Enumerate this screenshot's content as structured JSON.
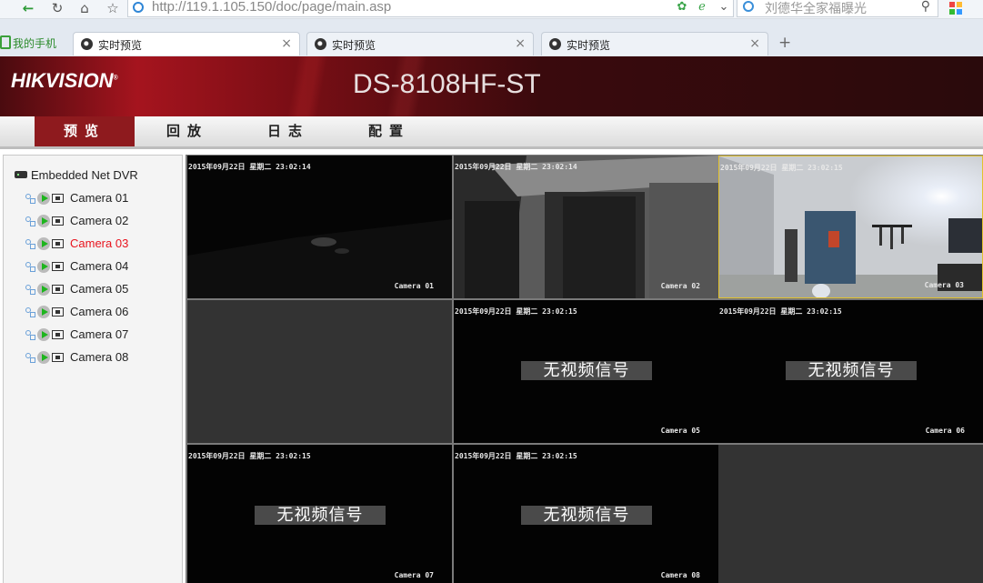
{
  "browser": {
    "url": "http://119.1.105.150/doc/page/main.asp",
    "search_text": "刘德华全家福曝光",
    "bookmark_label": "我的手机",
    "tabs": [
      {
        "label": "实时预览",
        "active": true
      },
      {
        "label": "实时预览",
        "active": false
      },
      {
        "label": "实时预览",
        "active": false
      }
    ],
    "close_glyph": "×",
    "new_tab_glyph": "+"
  },
  "header": {
    "brand": "HIKVISION",
    "model": "DS-8108HF-ST",
    "brand_color": "#a5141e"
  },
  "menu": {
    "items": [
      {
        "label": "预览",
        "active": true
      },
      {
        "label": "回放",
        "active": false
      },
      {
        "label": "日志",
        "active": false
      },
      {
        "label": "配置",
        "active": false
      }
    ],
    "active_color": "#8e1a1e"
  },
  "tree": {
    "root_label": "Embedded Net DVR",
    "cameras": [
      {
        "label": "Camera 01",
        "active": false
      },
      {
        "label": "Camera 02",
        "active": false
      },
      {
        "label": "Camera 03",
        "active": true
      },
      {
        "label": "Camera 04",
        "active": false
      },
      {
        "label": "Camera 05",
        "active": false
      },
      {
        "label": "Camera 06",
        "active": false
      },
      {
        "label": "Camera 07",
        "active": false
      },
      {
        "label": "Camera 08",
        "active": false
      }
    ]
  },
  "video": {
    "no_signal_text": "无视频信号",
    "panes": [
      {
        "osd": "2015年09月22日 星期二 23:02:14",
        "camera": "Camera 01",
        "state": "live"
      },
      {
        "osd": "2015年09月22日 星期二 23:02:14",
        "camera": "Camera 02",
        "state": "live"
      },
      {
        "osd": "2015年09月22日 星期二 23:02:15",
        "camera": "Camera 03",
        "state": "live",
        "selected": true
      },
      {
        "osd": "",
        "camera": "",
        "state": "empty"
      },
      {
        "osd": "2015年09月22日 星期二 23:02:15",
        "camera": "Camera 05",
        "state": "no-signal"
      },
      {
        "osd": "2015年09月22日 星期二 23:02:15",
        "camera": "Camera 06",
        "state": "no-signal"
      },
      {
        "osd": "2015年09月22日 星期二 23:02:15",
        "camera": "Camera 07",
        "state": "no-signal"
      },
      {
        "osd": "2015年09月22日 星期二 23:02:15",
        "camera": "Camera 08",
        "state": "no-signal"
      },
      {
        "osd": "",
        "camera": "",
        "state": "empty"
      }
    ]
  }
}
